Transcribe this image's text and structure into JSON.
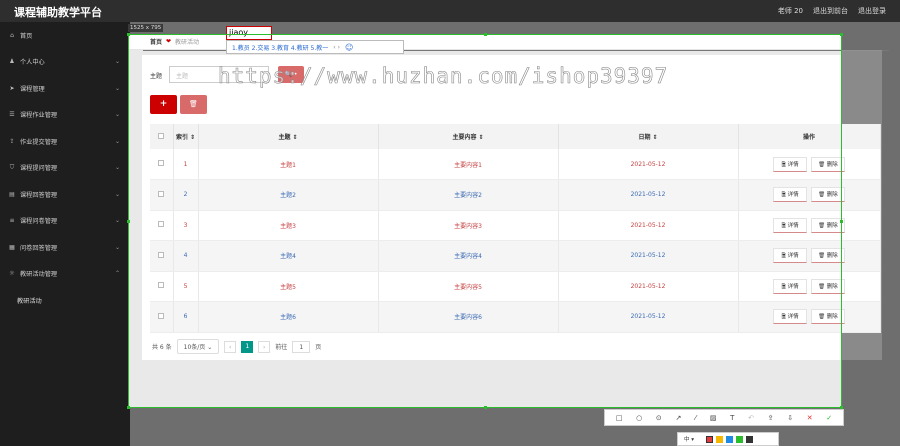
{
  "app": {
    "title": "课程辅助教学平台",
    "user": "老师 20",
    "exit_admin": "退出到前台",
    "logout": "退出登录"
  },
  "sidebar": {
    "items": [
      {
        "icon": "home-icon",
        "glyph": "⌂",
        "label": "首页",
        "arrow": ""
      },
      {
        "icon": "user-icon",
        "glyph": "♟",
        "label": "个人中心",
        "arrow": "⌄"
      },
      {
        "icon": "send-icon",
        "glyph": "➤",
        "label": "课程管理",
        "arrow": "⌄"
      },
      {
        "icon": "list-icon",
        "glyph": "☰",
        "label": "课程作业管理",
        "arrow": "⌄"
      },
      {
        "icon": "upload-icon",
        "glyph": "⇪",
        "label": "作业提交管理",
        "arrow": "⌄"
      },
      {
        "icon": "shield-icon",
        "glyph": "⛉",
        "label": "课程提问管理",
        "arrow": "⌄"
      },
      {
        "icon": "answer-icon",
        "glyph": "▤",
        "label": "课程回答管理",
        "arrow": "⌄"
      },
      {
        "icon": "menu-icon",
        "glyph": "≡",
        "label": "课程问卷管理",
        "arrow": "⌄"
      },
      {
        "icon": "doc-icon",
        "glyph": "▦",
        "label": "问卷回答管理",
        "arrow": "⌄"
      },
      {
        "icon": "lightbulb-icon",
        "glyph": "☼",
        "label": "教研活动管理",
        "arrow": "⌃"
      }
    ],
    "subitem": "教研活动"
  },
  "screenshot_tool": {
    "size_badge": "1525 x 795"
  },
  "breadcrumb": {
    "home": "首页",
    "heart": "❤",
    "current": "教研活动"
  },
  "search": {
    "label": "主题",
    "placeholder": "主题",
    "button": "🔍 •"
  },
  "ime": {
    "composition": "jiaoy",
    "candidates": "1.教员  2.交易  3.教育  4.教研  5.教一",
    "nav": "‹ ›",
    "emoji": "☺"
  },
  "actions": {
    "add": "+",
    "delete": "🗑"
  },
  "table": {
    "headers": {
      "index": "索引 ⇕",
      "topic": "主题 ⇕",
      "content": "主要内容 ⇕",
      "date": "日期 ⇕",
      "ops": "操作"
    },
    "detail_label": "🗎 详情",
    "delete_label": "🗑 删除",
    "rows": [
      {
        "index": "1",
        "topic": "主题1",
        "content": "主要内容1",
        "date": "2021-05-12"
      },
      {
        "index": "2",
        "topic": "主题2",
        "content": "主要内容2",
        "date": "2021-05-12"
      },
      {
        "index": "3",
        "topic": "主题3",
        "content": "主要内容3",
        "date": "2021-05-12"
      },
      {
        "index": "4",
        "topic": "主题4",
        "content": "主要内容4",
        "date": "2021-05-12"
      },
      {
        "index": "5",
        "topic": "主题5",
        "content": "主要内容5",
        "date": "2021-05-12"
      },
      {
        "index": "6",
        "topic": "主题6",
        "content": "主要内容6",
        "date": "2021-05-12"
      }
    ]
  },
  "pagination": {
    "total": "共 6 条",
    "per_page": "10条/页 ⌄",
    "prev": "‹",
    "current": "1",
    "next": "›",
    "goto": "前往",
    "page_input": "1",
    "page_suffix": "页"
  },
  "watermark": "https://www.huzhan.com/ishop39397",
  "toolbar": {
    "rect": "□",
    "circle": "○",
    "pen": "⊙",
    "arrow": "↗",
    "line": "⁄",
    "mosaic": "▨",
    "text": "T",
    "undo": "↶",
    "share": "⇪",
    "save": "⇩",
    "cancel": "✕",
    "confirm": "✓"
  },
  "colorbar": {
    "size": "中 ▾",
    "colors": [
      "#e33b3b",
      "#f5b800",
      "#1e8ae6",
      "#2bbd2b",
      "#333333",
      "#ffffff"
    ]
  }
}
